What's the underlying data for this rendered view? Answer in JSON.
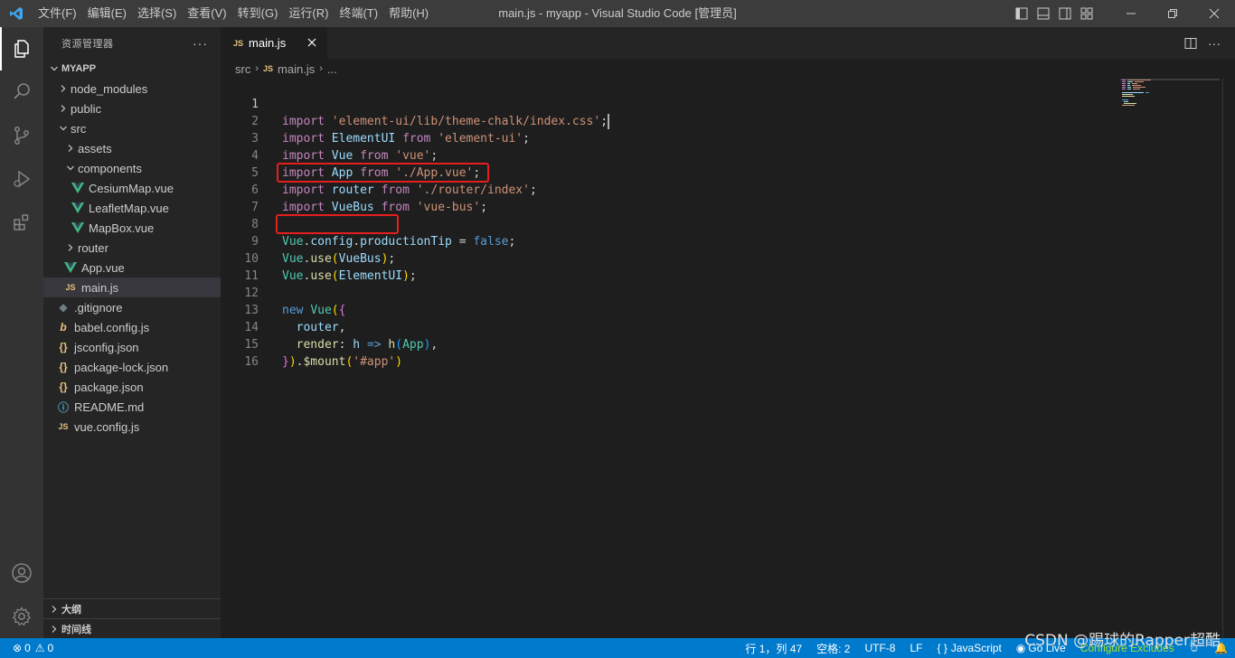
{
  "titlebar": {
    "menu": [
      "文件(F)",
      "编辑(E)",
      "选择(S)",
      "查看(V)",
      "转到(G)",
      "运行(R)",
      "终端(T)",
      "帮助(H)"
    ],
    "title": "main.js - myapp - Visual Studio Code [管理员]"
  },
  "sidebar": {
    "title": "资源管理器",
    "more": "···",
    "project": "MYAPP",
    "tree": [
      {
        "label": "node_modules",
        "type": "folder"
      },
      {
        "label": "public",
        "type": "folder"
      },
      {
        "label": "src",
        "type": "folder-open"
      },
      {
        "label": "assets",
        "type": "folder"
      },
      {
        "label": "components",
        "type": "folder-open"
      },
      {
        "label": "CesiumMap.vue",
        "type": "vue"
      },
      {
        "label": "LeafletMap.vue",
        "type": "vue"
      },
      {
        "label": "MapBox.vue",
        "type": "vue"
      },
      {
        "label": "router",
        "type": "folder"
      },
      {
        "label": "App.vue",
        "type": "vue"
      },
      {
        "label": "main.js",
        "type": "js"
      },
      {
        "label": ".gitignore",
        "type": "git"
      },
      {
        "label": "babel.config.js",
        "type": "babel"
      },
      {
        "label": "jsconfig.json",
        "type": "json"
      },
      {
        "label": "package-lock.json",
        "type": "json"
      },
      {
        "label": "package.json",
        "type": "json"
      },
      {
        "label": "README.md",
        "type": "info"
      },
      {
        "label": "vue.config.js",
        "type": "js"
      }
    ],
    "outline": "大纲",
    "timeline": "时间线"
  },
  "editor": {
    "tab_label": "main.js",
    "tab_icon": "JS",
    "breadcrumb": {
      "folder": "src",
      "file": "main.js",
      "more": "..."
    },
    "line_numbers": [
      "1",
      "2",
      "3",
      "4",
      "5",
      "6",
      "7",
      "8",
      "9",
      "10",
      "11",
      "12",
      "13",
      "14",
      "15",
      "16"
    ],
    "code": {
      "l1": {
        "kw": "import",
        "str": "'element-ui/lib/theme-chalk/index.css'",
        "semi": ";"
      },
      "l2": {
        "kw": "import",
        "id": "ElementUI",
        "from": "from",
        "str": "'element-ui'",
        "semi": ";"
      },
      "l3": {
        "kw": "import",
        "id": "Vue",
        "from": "from",
        "str": "'vue'",
        "semi": ";"
      },
      "l4": {
        "kw": "import",
        "id": "App",
        "from": "from",
        "str": "'./App.vue'",
        "semi": ";"
      },
      "l5": {
        "kw": "import",
        "id": "router",
        "from": "from",
        "str": "'./router/index'",
        "semi": ";"
      },
      "l6": {
        "kw": "import",
        "id": "VueBus",
        "from": "from",
        "str": "'vue-bus'",
        "semi": ";"
      },
      "l8": {
        "obj": "Vue",
        "p1": "config",
        "p2": "productionTip",
        "op": "=",
        "val": "false",
        "semi": ";"
      },
      "l9": {
        "obj": "Vue",
        "fn": "use",
        "arg": "VueBus",
        "semi": ";"
      },
      "l10": {
        "obj": "Vue",
        "fn": "use",
        "arg": "ElementUI",
        "semi": ";"
      },
      "l12": {
        "kw": "new",
        "cls": "Vue"
      },
      "l13": {
        "prop": "router",
        "comma": ","
      },
      "l14": {
        "prop": "render",
        "param": "h",
        "arrow": "=>",
        "fn": "h",
        "arg": "App",
        "comma": ","
      },
      "l15": {
        "fn": "$mount",
        "str": "'#app'"
      }
    }
  },
  "statusbar": {
    "errors": "0",
    "warnings": "0",
    "position": "行 1，列 47",
    "spaces": "空格: 2",
    "encoding": "UTF-8",
    "eol": "LF",
    "language": "JavaScript",
    "golive": "Go Live",
    "configure": "Configure Excludes"
  },
  "watermark": "CSDN @踢球的Rapper超酷",
  "colors": {
    "accent": "#007acc",
    "highlight_box": "#e51e1e"
  }
}
